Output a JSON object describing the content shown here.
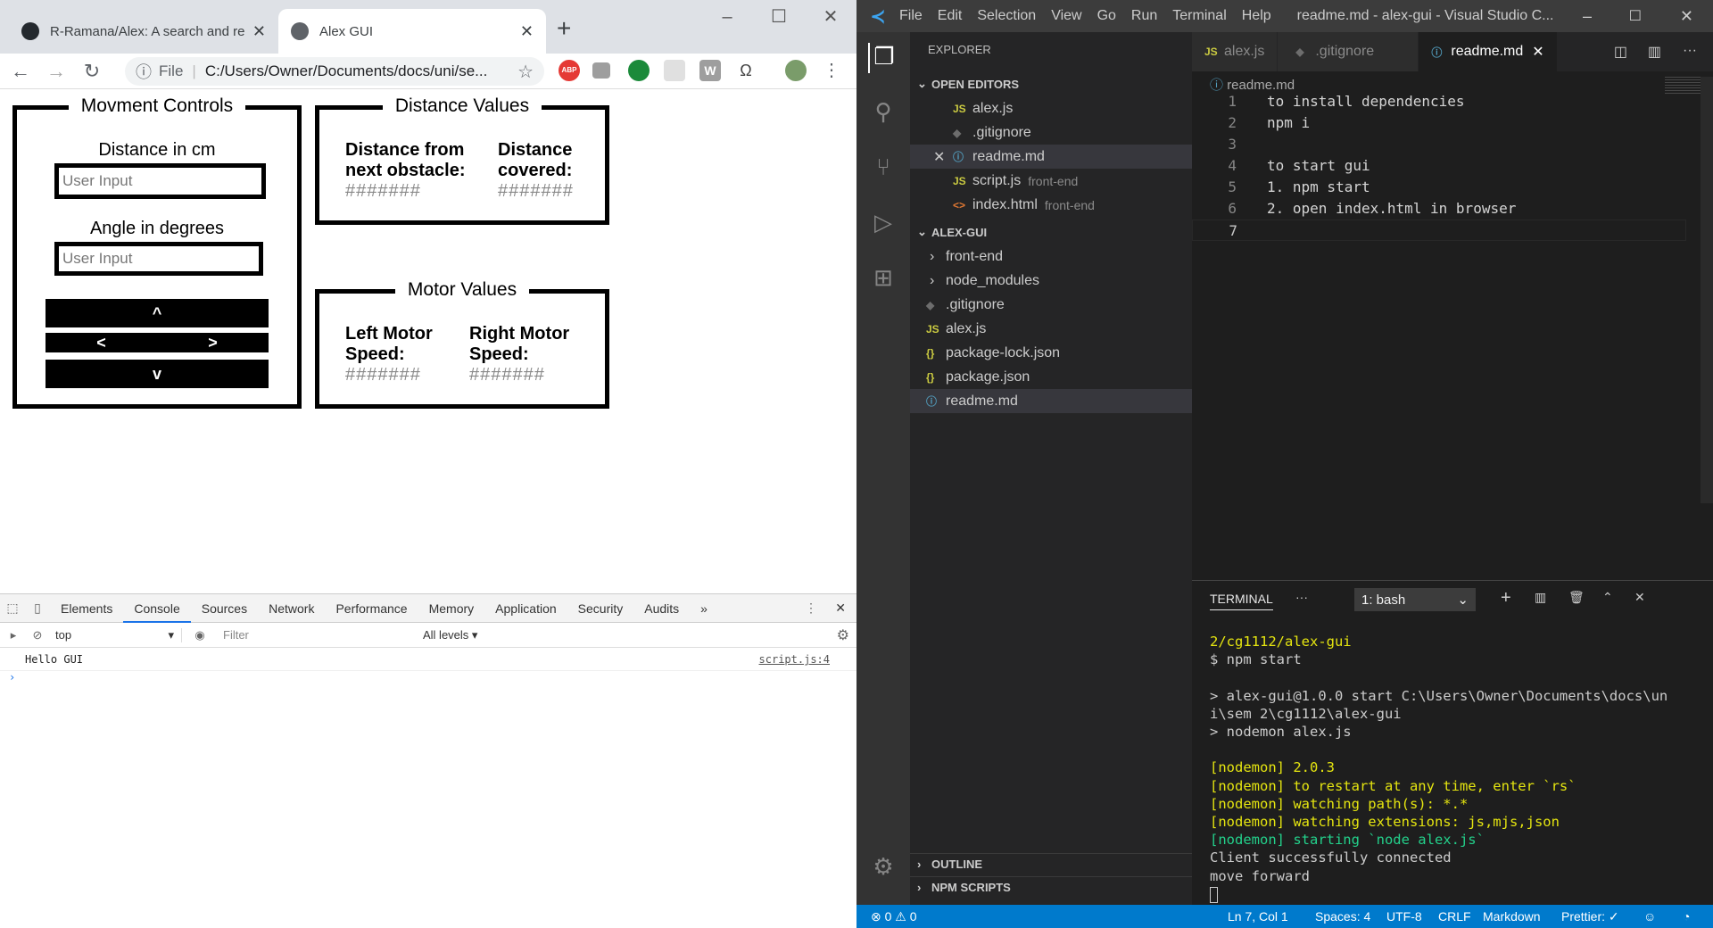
{
  "browser": {
    "tabs": [
      {
        "title": "R-Ramana/Alex: A search and res",
        "icon": "github-icon",
        "active": false
      },
      {
        "title": "Alex GUI",
        "icon": "globe-icon",
        "active": true
      }
    ],
    "new_tab": "+",
    "window_buttons": [
      "–",
      "☐",
      "✕"
    ],
    "nav": {
      "back": "←",
      "forward": "→",
      "reload": "↻"
    },
    "address": {
      "scheme": "File",
      "url": "C:/Users/Owner/Documents/docs/uni/se...",
      "info_icon": "ⓘ",
      "star": "☆"
    },
    "ext_icons": [
      "abp-icon",
      "ext-gray-icon",
      "ext-green-icon",
      "ext-blank-icon",
      "ext-w-icon",
      "omega-icon",
      "profile-avatar",
      "kebab-menu-icon"
    ],
    "ext_labels": {
      "abp": "ABP",
      "w": "W",
      "omega": "Ω",
      "kebab": "⋮"
    }
  },
  "page": {
    "movement": {
      "legend": "Movment Controls",
      "distance_label": "Distance in cm",
      "distance_placeholder": "User Input",
      "angle_label": "Angle in degrees",
      "angle_placeholder": "User Input",
      "up": "^",
      "left": "<",
      "right": ">",
      "down": "v"
    },
    "distance": {
      "legend": "Distance Values",
      "obstacle_label": "Distance from next obstacle:",
      "obstacle_value": "#######",
      "covered_label": "Distance covered:",
      "covered_value": "#######"
    },
    "motor": {
      "legend": "Motor Values",
      "left_label": "Left Motor Speed:",
      "left_value": "#######",
      "right_label": "Right Motor Speed:",
      "right_value": "#######"
    }
  },
  "devtools": {
    "tabs": [
      "Elements",
      "Console",
      "Sources",
      "Network",
      "Performance",
      "Memory",
      "Application",
      "Security",
      "Audits",
      "»"
    ],
    "active_tab": "Console",
    "context": "top",
    "filter_placeholder": "Filter",
    "levels": "All levels ▾",
    "log": {
      "text": "Hello GUI",
      "source": "script.js:4"
    },
    "prompt": "›"
  },
  "vscode": {
    "menu": [
      "File",
      "Edit",
      "Selection",
      "View",
      "Go",
      "Run",
      "Terminal",
      "Help"
    ],
    "title": "readme.md - alex-gui - Visual Studio C...",
    "explorer_title": "EXPLORER",
    "open_editors_title": "OPEN EDITORS",
    "open_editors": [
      {
        "name": "alex.js",
        "desc": "",
        "type": "js"
      },
      {
        "name": ".gitignore",
        "desc": "",
        "type": "git"
      },
      {
        "name": "readme.md",
        "desc": "",
        "type": "info",
        "selected": true
      },
      {
        "name": "script.js",
        "desc": "front-end",
        "type": "js"
      },
      {
        "name": "index.html",
        "desc": "front-end",
        "type": "html"
      }
    ],
    "project_title": "ALEX-GUI",
    "project": [
      {
        "name": "front-end",
        "type": "folder"
      },
      {
        "name": "node_modules",
        "type": "folder"
      },
      {
        "name": ".gitignore",
        "type": "git"
      },
      {
        "name": "alex.js",
        "type": "js"
      },
      {
        "name": "package-lock.json",
        "type": "json"
      },
      {
        "name": "package.json",
        "type": "json"
      },
      {
        "name": "readme.md",
        "type": "info",
        "selected": true
      }
    ],
    "outline": "OUTLINE",
    "npm_scripts": "NPM SCRIPTS",
    "editor_tabs": [
      "alex.js",
      ".gitignore",
      "readme.md"
    ],
    "active_editor_tab": "readme.md",
    "breadcrumb": "readme.md",
    "code_lines": [
      "to install dependencies",
      "npm i",
      "",
      "to start gui",
      "1. npm start",
      "2. open index.html in browser",
      ""
    ],
    "terminal": {
      "title": "TERMINAL",
      "more": "···",
      "shell": "1: bash",
      "lines": [
        {
          "text": "2/cg1112/alex-gui",
          "color": "#e5e510"
        },
        {
          "text": "$ npm start",
          "color": "#cccccc"
        },
        {
          "text": "",
          "color": "#cccccc"
        },
        {
          "text": "> alex-gui@1.0.0 start C:\\Users\\Owner\\Documents\\docs\\un",
          "color": "#cccccc"
        },
        {
          "text": "i\\sem 2\\cg1112\\alex-gui",
          "color": "#cccccc"
        },
        {
          "text": "> nodemon alex.js",
          "color": "#cccccc"
        },
        {
          "text": "",
          "color": "#cccccc"
        },
        {
          "text": "[nodemon] 2.0.3",
          "color": "#e5e510"
        },
        {
          "text": "[nodemon] to restart at any time, enter `rs`",
          "color": "#e5e510"
        },
        {
          "text": "[nodemon] watching path(s): *.*",
          "color": "#e5e510"
        },
        {
          "text": "[nodemon] watching extensions: js,mjs,json",
          "color": "#e5e510"
        },
        {
          "text": "[nodemon] starting `node alex.js`",
          "color": "#23d18b"
        },
        {
          "text": "Client successfully connected",
          "color": "#cccccc"
        },
        {
          "text": "move forward",
          "color": "#cccccc"
        }
      ]
    },
    "status": {
      "problems": "⊗ 0 ⚠ 0",
      "position": "Ln 7, Col 1",
      "spaces": "Spaces: 4",
      "encoding": "UTF-8",
      "eol": "CRLF",
      "language": "Markdown",
      "prettier": "Prettier: ✓",
      "feedback": "☺",
      "bell": "🔔"
    }
  }
}
